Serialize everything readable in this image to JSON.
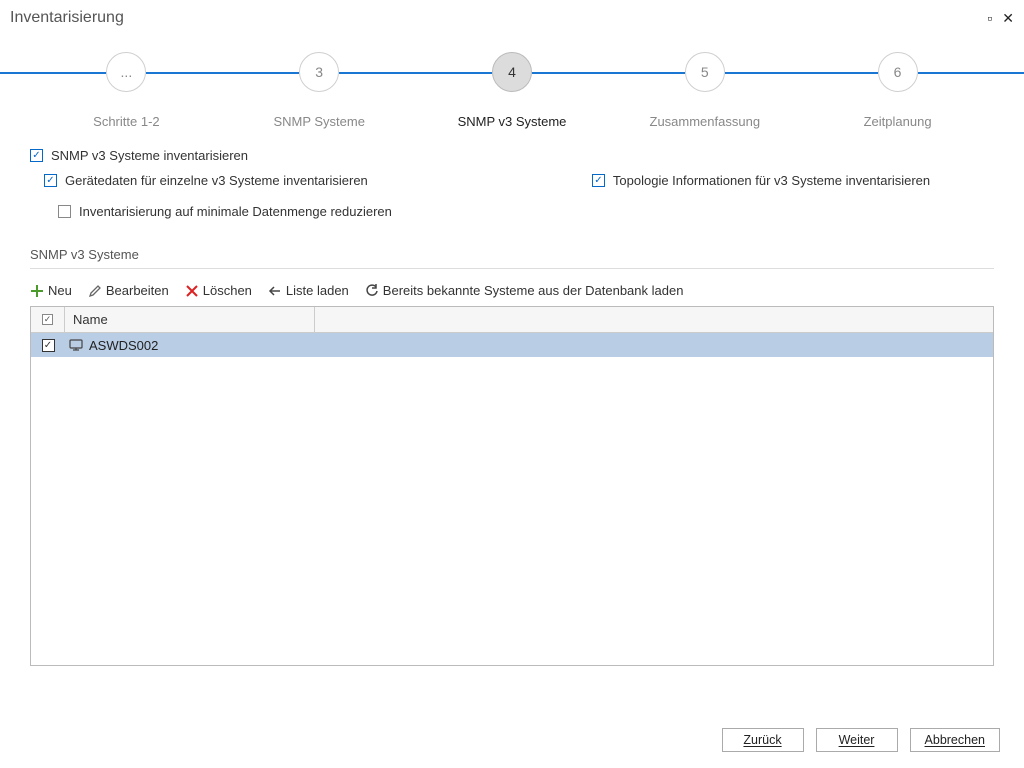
{
  "window": {
    "title": "Inventarisierung"
  },
  "steps": [
    {
      "num": "...",
      "label": "Schritte 1-2"
    },
    {
      "num": "3",
      "label": "SNMP Systeme"
    },
    {
      "num": "4",
      "label": "SNMP v3 Systeme",
      "active": true
    },
    {
      "num": "5",
      "label": "Zusammenfassung"
    },
    {
      "num": "6",
      "label": "Zeitplanung"
    }
  ],
  "checks": {
    "main": {
      "label": "SNMP v3 Systeme inventarisieren",
      "checked": true
    },
    "devdata": {
      "label": "Gerätedaten für einzelne v3 Systeme inventarisieren",
      "checked": true
    },
    "topo": {
      "label": "Topologie Informationen für v3 Systeme inventarisieren",
      "checked": true
    },
    "minimal": {
      "label": "Inventarisierung auf minimale Datenmenge reduzieren",
      "checked": false
    }
  },
  "section": {
    "title": "SNMP v3 Systeme"
  },
  "toolbar": {
    "neu": "Neu",
    "bearbeiten": "Bearbeiten",
    "loeschen": "Löschen",
    "listeladen": "Liste laden",
    "dbladen": "Bereits bekannte Systeme aus der Datenbank laden"
  },
  "table": {
    "header_checked": true,
    "columns": {
      "name": "Name"
    },
    "rows": [
      {
        "checked": true,
        "name": "ASWDS002"
      }
    ]
  },
  "buttons": {
    "back": "Zurück",
    "next": "Weiter",
    "cancel": "Abbrechen"
  }
}
